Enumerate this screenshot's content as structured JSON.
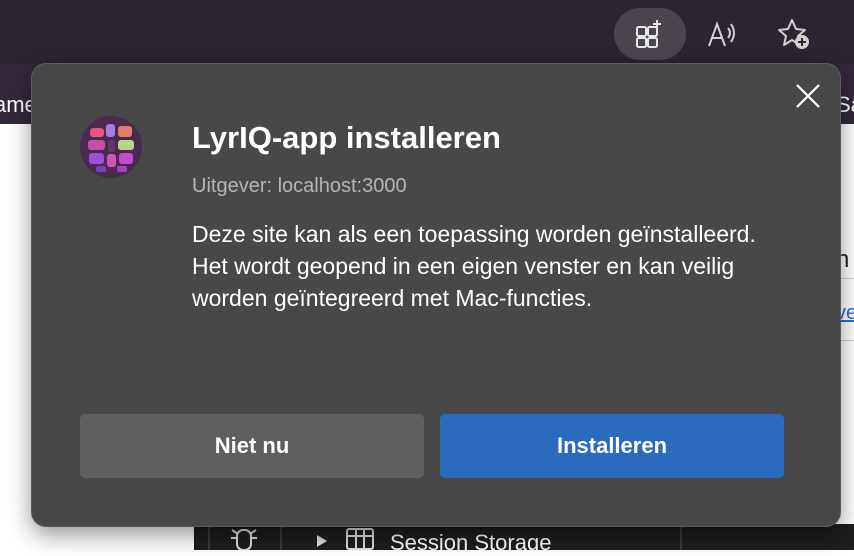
{
  "browser": {
    "tabstrip_left_text": "ame",
    "tabstrip_right_text": "Sa",
    "page_right_heading": "n",
    "page_right_link": "ve",
    "devtools": {
      "session_storage_label": "Session Storage"
    }
  },
  "dialog": {
    "title": "LyrIQ-app installeren",
    "publisher": "Uitgever: localhost:3000",
    "description": "Deze site kan als een toepassing worden geïnstalleerd. Het wordt geopend in een eigen venster en kan veilig worden geïntegreerd met Mac-functies.",
    "cancel_label": "Niet nu",
    "install_label": "Installeren"
  },
  "colors": {
    "dialog_bg": "#484848",
    "primary_button": "#2b6bbd",
    "secondary_button": "#5f5f5f"
  }
}
